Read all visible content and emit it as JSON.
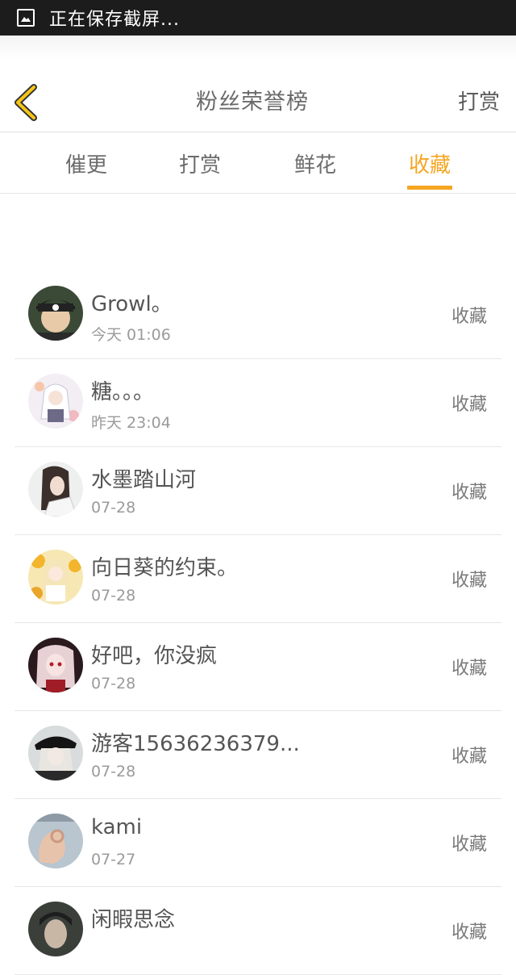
{
  "status_bar": {
    "text": "正在保存截屏...",
    "icon": "screenshot-gallery-icon"
  },
  "header": {
    "back_icon": "chevron-left-icon",
    "title": "粉丝荣誉榜",
    "action_label": "打赏"
  },
  "tabs": [
    {
      "label": "催更",
      "active": false
    },
    {
      "label": "打赏",
      "active": false
    },
    {
      "label": "鲜花",
      "active": false
    },
    {
      "label": "收藏",
      "active": true
    }
  ],
  "colors": {
    "accent": "#f5a623",
    "status_bar_bg": "#1c1c1c",
    "divider": "#e6e6e6"
  },
  "fans": [
    {
      "name": "Growl。",
      "time": "今天 01:06",
      "action": "收藏",
      "avatar_icon": "avatar-boy-cap"
    },
    {
      "name": "糖。。。",
      "time": "昨天 23:04",
      "action": "收藏",
      "avatar_icon": "avatar-anime-white-hair"
    },
    {
      "name": "水墨踏山河",
      "time": "07-28",
      "action": "收藏",
      "avatar_icon": "avatar-ancient-swordsman"
    },
    {
      "name": "向日葵的约束。",
      "time": "07-28",
      "action": "收藏",
      "avatar_icon": "avatar-anime-sunflower"
    },
    {
      "name": "好吧，你没疯",
      "time": "07-28",
      "action": "收藏",
      "avatar_icon": "avatar-anime-red"
    },
    {
      "name": "游客15636236379...",
      "time": "07-28",
      "action": "收藏",
      "avatar_icon": "avatar-hat-person"
    },
    {
      "name": "kami",
      "time": "07-27",
      "action": "收藏",
      "avatar_icon": "avatar-hand-gesture"
    },
    {
      "name": "闲暇思念",
      "time": "",
      "action": "收藏",
      "avatar_icon": "avatar-dark-portrait"
    }
  ]
}
